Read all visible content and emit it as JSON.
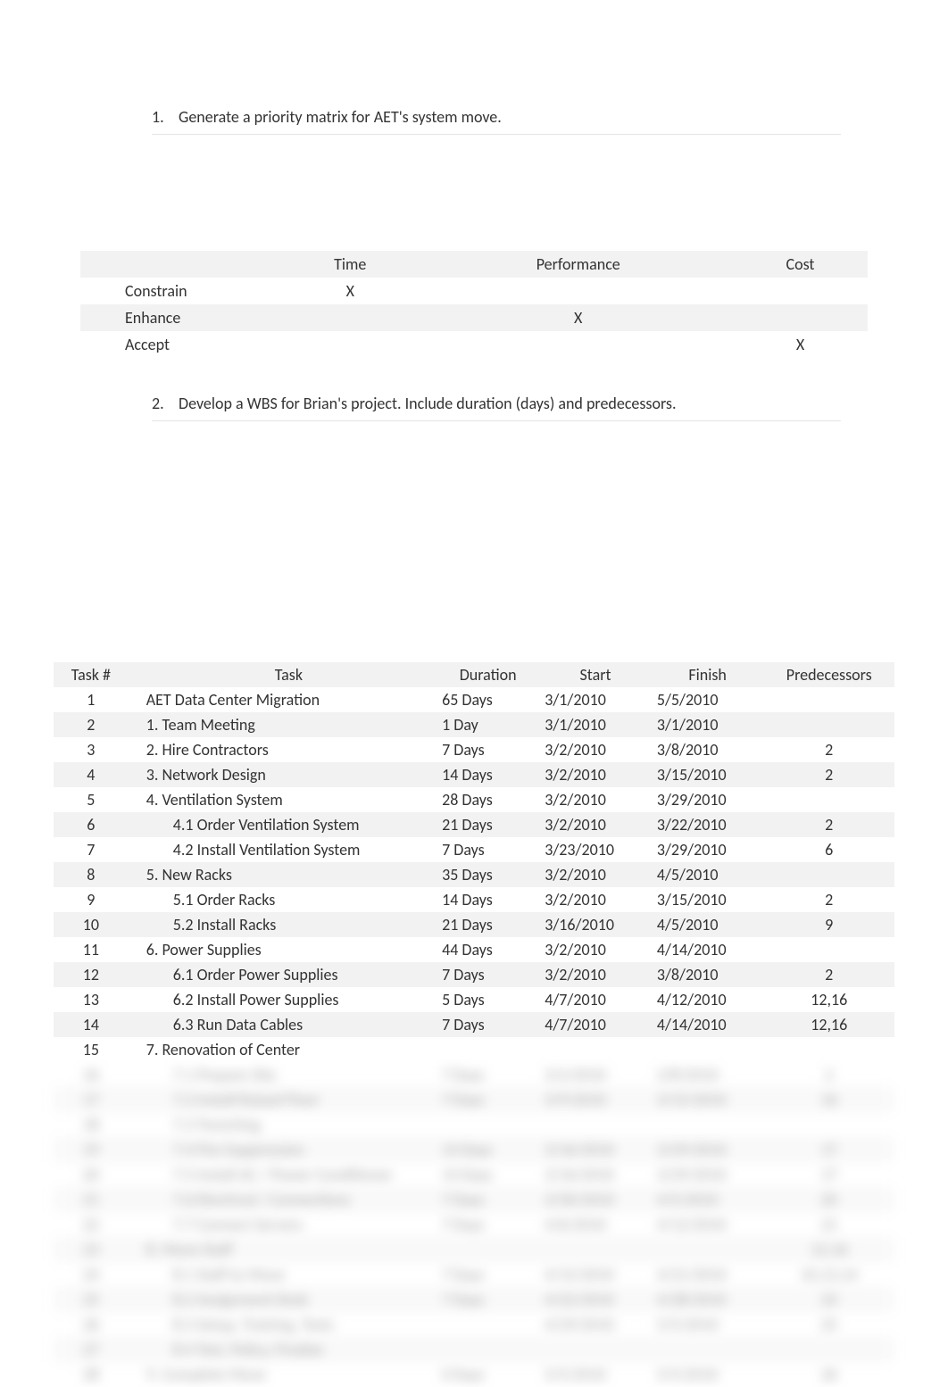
{
  "q1": {
    "num": "1.",
    "text": "Generate a priority matrix for AET's system move."
  },
  "q2": {
    "num": "2.",
    "text": "Develop a WBS for Brian's project. Include duration (days) and predecessors."
  },
  "matrix": {
    "headers": [
      "",
      "Time",
      "Performance",
      "Cost"
    ],
    "rows": [
      {
        "label": "Constrain",
        "time": "X",
        "perf": "",
        "cost": ""
      },
      {
        "label": "Enhance",
        "time": "",
        "perf": "X",
        "cost": ""
      },
      {
        "label": "Accept",
        "time": "",
        "perf": "",
        "cost": "X"
      }
    ]
  },
  "wbs": {
    "headers": {
      "num": "Task #",
      "task": "Task",
      "dur": "Duration",
      "start": "Start",
      "fin": "Finish",
      "pred": "Predecessors"
    },
    "rows": [
      {
        "n": "1",
        "t": "AET Data Center Migration",
        "ind": 0,
        "d": "65 Days",
        "s": "3/1/2010",
        "f": "5/5/2010",
        "p": ""
      },
      {
        "n": "2",
        "t": "1. Team Meeting",
        "ind": 0,
        "d": "1 Day",
        "s": "3/1/2010",
        "f": "3/1/2010",
        "p": ""
      },
      {
        "n": "3",
        "t": "2. Hire Contractors",
        "ind": 0,
        "d": "7 Days",
        "s": "3/2/2010",
        "f": "3/8/2010",
        "p": "2"
      },
      {
        "n": "4",
        "t": "3. Network Design",
        "ind": 0,
        "d": "14 Days",
        "s": "3/2/2010",
        "f": "3/15/2010",
        "p": "2"
      },
      {
        "n": "5",
        "t": "4. Ventilation System",
        "ind": 0,
        "d": "28 Days",
        "s": "3/2/2010",
        "f": "3/29/2010",
        "p": ""
      },
      {
        "n": "6",
        "t": "4.1 Order Ventilation System",
        "ind": 1,
        "d": "21 Days",
        "s": "3/2/2010",
        "f": "3/22/2010",
        "p": "2"
      },
      {
        "n": "7",
        "t": "4.2 Install Ventilation System",
        "ind": 1,
        "d": "7 Days",
        "s": "3/23/2010",
        "f": "3/29/2010",
        "p": "6"
      },
      {
        "n": "8",
        "t": "5. New Racks",
        "ind": 0,
        "d": "35 Days",
        "s": "3/2/2010",
        "f": "4/5/2010",
        "p": ""
      },
      {
        "n": "9",
        "t": "5.1 Order Racks",
        "ind": 1,
        "d": "14 Days",
        "s": "3/2/2010",
        "f": "3/15/2010",
        "p": "2"
      },
      {
        "n": "10",
        "t": "5.2 Install Racks",
        "ind": 1,
        "d": "21 Days",
        "s": "3/16/2010",
        "f": "4/5/2010",
        "p": "9"
      },
      {
        "n": "11",
        "t": "6. Power Supplies",
        "ind": 0,
        "d": "44 Days",
        "s": "3/2/2010",
        "f": "4/14/2010",
        "p": ""
      },
      {
        "n": "12",
        "t": "6.1 Order Power Supplies",
        "ind": 1,
        "d": "7 Days",
        "s": "3/2/2010",
        "f": "3/8/2010",
        "p": "2"
      },
      {
        "n": "13",
        "t": "6.2 Install Power Supplies",
        "ind": 1,
        "d": "5 Days",
        "s": "4/7/2010",
        "f": "4/12/2010",
        "p": "12,16"
      },
      {
        "n": "14",
        "t": "6.3 Run Data Cables",
        "ind": 1,
        "d": "7 Days",
        "s": "4/7/2010",
        "f": "4/14/2010",
        "p": "12,16"
      },
      {
        "n": "15",
        "t": "7. Renovation of Center",
        "ind": 0,
        "d": "",
        "s": "",
        "f": "",
        "p": ""
      }
    ],
    "blurred_rows": [
      {
        "n": "16",
        "t": "7.1 Prepare Site",
        "ind": 1,
        "d": "7 Days",
        "s": "3/2/2010",
        "f": "3/8/2010",
        "p": "2"
      },
      {
        "n": "17",
        "t": "7.2 Install Raised Floor",
        "ind": 1,
        "d": "7 Days",
        "s": "3/9/2010",
        "f": "3/15/2010",
        "p": "16"
      },
      {
        "n": "18",
        "t": "7.3 Trenching",
        "ind": 1,
        "d": "",
        "s": "",
        "f": "",
        "p": ""
      },
      {
        "n": "19",
        "t": "7.4 Fire Suppression",
        "ind": 1,
        "d": "14 Days",
        "s": "3/16/2010",
        "f": "3/29/2010",
        "p": "17"
      },
      {
        "n": "20",
        "t": "7.5 Install AC / Power Conditioner",
        "ind": 1,
        "d": "14 Days",
        "s": "3/16/2010",
        "f": "3/29/2010",
        "p": "17"
      },
      {
        "n": "21",
        "t": "7.6 Electrical / Connections",
        "ind": 1,
        "d": "7 Days",
        "s": "3/30/2010",
        "f": "4/5/2010",
        "p": "20"
      },
      {
        "n": "22",
        "t": "7.7 Connect Servers",
        "ind": 1,
        "d": "7 Days",
        "s": "4/6/2010",
        "f": "4/12/2010",
        "p": "21"
      },
      {
        "n": "23",
        "t": "8. Move Staff",
        "ind": 0,
        "d": "",
        "s": "",
        "f": "",
        "p": "12,16"
      },
      {
        "n": "24",
        "t": "8.1 Staff to Move",
        "ind": 1,
        "d": "7 Days",
        "s": "4/15/2010",
        "f": "4/21/2010",
        "p": "10,13,14"
      },
      {
        "n": "25",
        "t": "8.2 Assignment Desk",
        "ind": 1,
        "d": "7 Days",
        "s": "4/22/2010",
        "f": "4/28/2010",
        "p": "24"
      },
      {
        "n": "26",
        "t": "8.3 Setup, Training, Tests",
        "ind": 1,
        "d": "",
        "s": "4/29/2010",
        "f": "5/5/2010",
        "p": "25"
      },
      {
        "n": "27",
        "t": "8.4 Test, Policy, Finalize",
        "ind": 1,
        "d": "",
        "s": "",
        "f": "",
        "p": ""
      },
      {
        "n": "28",
        "t": "9. Complete Move",
        "ind": 0,
        "d": "0 Days",
        "s": "5/5/2010",
        "f": "5/5/2010",
        "p": "26"
      }
    ]
  }
}
